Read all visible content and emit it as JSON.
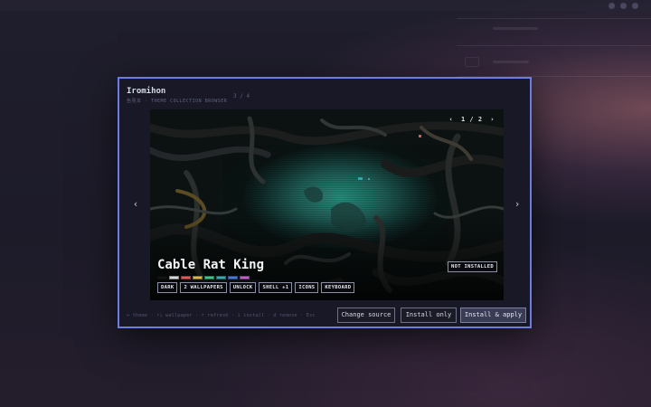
{
  "dialog": {
    "title": "Iromihon",
    "subtitle": "色見本 · THEME COLLECTION BROWSER",
    "position": "3 / 4"
  },
  "preview": {
    "pager": {
      "prev": "‹",
      "label": "1 / 2",
      "next": "›"
    },
    "theme_name": "Cable Rat King",
    "status_badge": "NOT INSTALLED",
    "swatches": [
      "#141414",
      "#d9d9d9",
      "#e05a5a",
      "#d8b84a",
      "#3fc48a",
      "#3aa8b0",
      "#4a78d8",
      "#c060c8"
    ],
    "tags": [
      "DARK",
      "2 WALLPAPERS",
      "UNLOCK",
      "SHELL +1",
      "ICONS",
      "KEYBOARD"
    ],
    "nav": {
      "prev": "‹",
      "next": "›"
    }
  },
  "footer": {
    "hints": "↔ theme · ↑↓ wallpaper · r refresh · i install · d remove · Esc",
    "buttons": {
      "change_source": "Change source",
      "install_only": "Install only",
      "install_apply": "Install & apply"
    }
  },
  "colors": {
    "accent": "#6b7de0",
    "dialog_bg": "#181826"
  }
}
